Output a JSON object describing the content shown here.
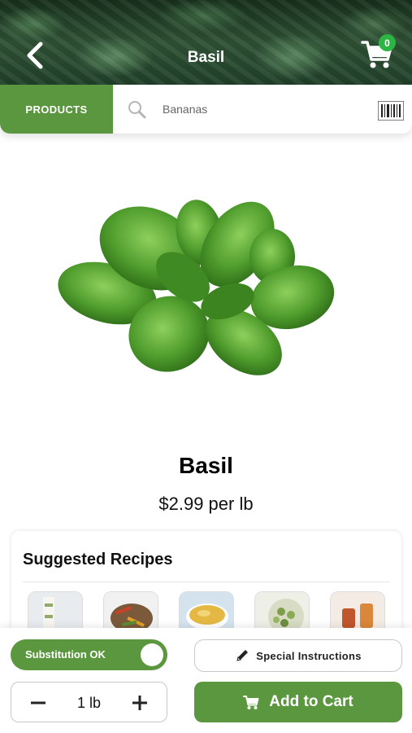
{
  "header": {
    "title": "Basil",
    "cart_count": "0",
    "back_icon": "chevron-left-icon",
    "cart_icon": "shopping-cart-icon"
  },
  "search": {
    "tab_label": "PRODUCTS",
    "placeholder": "Bananas",
    "search_icon": "search-icon",
    "barcode_icon": "barcode-icon"
  },
  "product": {
    "name": "Basil",
    "price": "$2.99 per lb"
  },
  "recipes": {
    "title": "Suggested Recipes",
    "items": [
      {
        "icon": "recipe-1"
      },
      {
        "icon": "recipe-2"
      },
      {
        "icon": "recipe-3"
      },
      {
        "icon": "recipe-4"
      },
      {
        "icon": "recipe-5"
      }
    ]
  },
  "actions": {
    "substitution_label": "Substitution OK",
    "substitution_on": true,
    "special_instructions_label": "Special Instructions",
    "quantity": "1 lb",
    "add_to_cart_label": "Add to Cart"
  },
  "colors": {
    "accent": "#5b973e",
    "badge": "#2db543"
  }
}
